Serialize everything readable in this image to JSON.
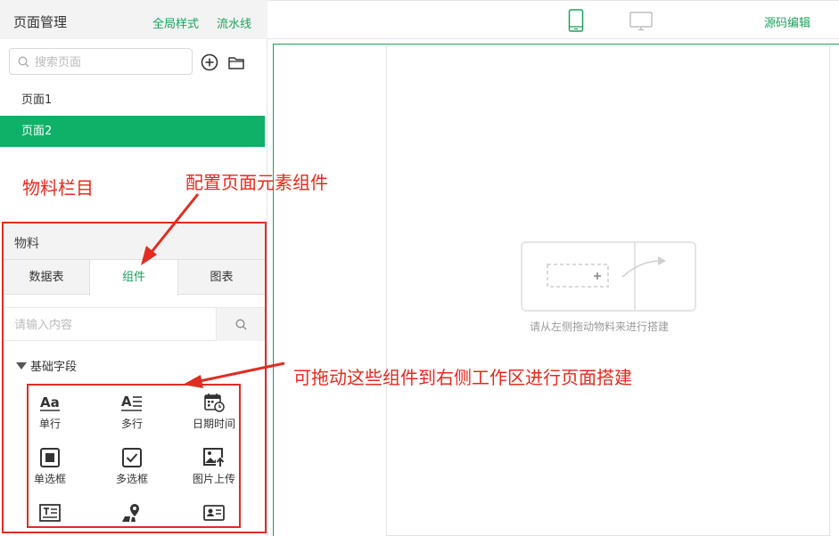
{
  "sidebar": {
    "title": "页面管理",
    "global_style_link": "全局样式",
    "pipeline_link": "流水线",
    "search": {
      "placeholder": "搜索页面",
      "value": ""
    },
    "pages": [
      {
        "label": "页面1",
        "selected": false
      },
      {
        "label": "页面2",
        "selected": true
      }
    ]
  },
  "annotations": {
    "materials_label": "物料栏目",
    "config_label": "配置页面元素组件",
    "drag_label": "可拖动这些组件到右侧工作区进行页面搭建"
  },
  "materials": {
    "title": "物料",
    "tabs": [
      {
        "label": "数据表",
        "active": false
      },
      {
        "label": "组件",
        "active": true
      },
      {
        "label": "图表",
        "active": false
      }
    ],
    "search": {
      "placeholder": "请输入内容",
      "value": ""
    },
    "group_title": "基础字段",
    "components": [
      {
        "label": "单行",
        "icon": "single-line-icon"
      },
      {
        "label": "多行",
        "icon": "multi-line-icon"
      },
      {
        "label": "日期时间",
        "icon": "calendar-clock-icon"
      },
      {
        "label": "单选框",
        "icon": "radio-square-icon"
      },
      {
        "label": "多选框",
        "icon": "checkbox-icon"
      },
      {
        "label": "图片上传",
        "icon": "image-upload-icon"
      },
      {
        "label": "",
        "icon": "text-area-icon"
      },
      {
        "label": "",
        "icon": "location-icon"
      },
      {
        "label": "",
        "icon": "id-card-icon"
      }
    ]
  },
  "topbar": {
    "source_edit": "源码编辑",
    "device_icons": [
      "phone-icon",
      "desktop-icon"
    ]
  },
  "canvas": {
    "empty_hint": "请从左侧拖动物料来进行搭建"
  },
  "colors": {
    "accent": "#1aa35b",
    "selected_bg": "#0fb068",
    "annotation": "#e02c22"
  }
}
